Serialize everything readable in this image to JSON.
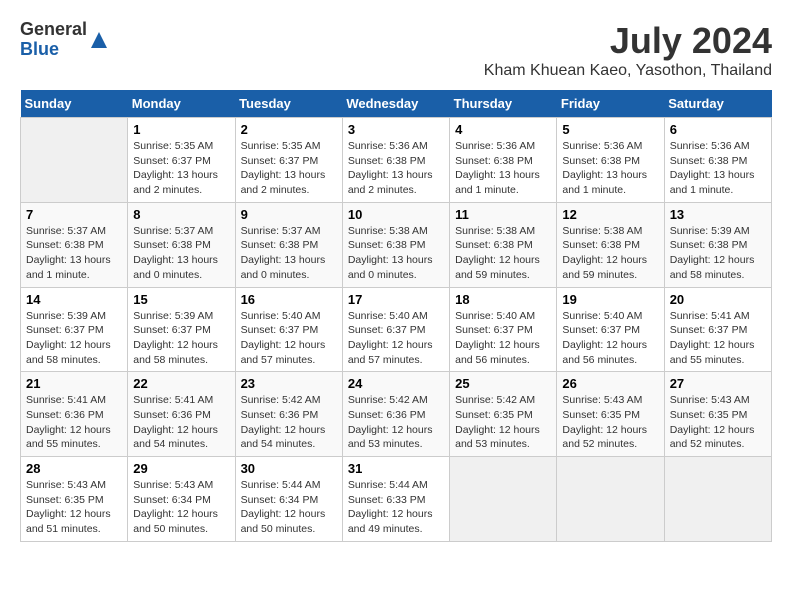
{
  "header": {
    "logo_general": "General",
    "logo_blue": "Blue",
    "month_title": "July 2024",
    "location": "Kham Khuean Kaeo, Yasothon, Thailand"
  },
  "days_of_week": [
    "Sunday",
    "Monday",
    "Tuesday",
    "Wednesday",
    "Thursday",
    "Friday",
    "Saturday"
  ],
  "weeks": [
    [
      {
        "day": "",
        "info": ""
      },
      {
        "day": "1",
        "info": "Sunrise: 5:35 AM\nSunset: 6:37 PM\nDaylight: 13 hours\nand 2 minutes."
      },
      {
        "day": "2",
        "info": "Sunrise: 5:35 AM\nSunset: 6:37 PM\nDaylight: 13 hours\nand 2 minutes."
      },
      {
        "day": "3",
        "info": "Sunrise: 5:36 AM\nSunset: 6:38 PM\nDaylight: 13 hours\nand 2 minutes."
      },
      {
        "day": "4",
        "info": "Sunrise: 5:36 AM\nSunset: 6:38 PM\nDaylight: 13 hours\nand 1 minute."
      },
      {
        "day": "5",
        "info": "Sunrise: 5:36 AM\nSunset: 6:38 PM\nDaylight: 13 hours\nand 1 minute."
      },
      {
        "day": "6",
        "info": "Sunrise: 5:36 AM\nSunset: 6:38 PM\nDaylight: 13 hours\nand 1 minute."
      }
    ],
    [
      {
        "day": "7",
        "info": "Sunrise: 5:37 AM\nSunset: 6:38 PM\nDaylight: 13 hours\nand 1 minute."
      },
      {
        "day": "8",
        "info": "Sunrise: 5:37 AM\nSunset: 6:38 PM\nDaylight: 13 hours\nand 0 minutes."
      },
      {
        "day": "9",
        "info": "Sunrise: 5:37 AM\nSunset: 6:38 PM\nDaylight: 13 hours\nand 0 minutes."
      },
      {
        "day": "10",
        "info": "Sunrise: 5:38 AM\nSunset: 6:38 PM\nDaylight: 13 hours\nand 0 minutes."
      },
      {
        "day": "11",
        "info": "Sunrise: 5:38 AM\nSunset: 6:38 PM\nDaylight: 12 hours\nand 59 minutes."
      },
      {
        "day": "12",
        "info": "Sunrise: 5:38 AM\nSunset: 6:38 PM\nDaylight: 12 hours\nand 59 minutes."
      },
      {
        "day": "13",
        "info": "Sunrise: 5:39 AM\nSunset: 6:38 PM\nDaylight: 12 hours\nand 58 minutes."
      }
    ],
    [
      {
        "day": "14",
        "info": "Sunrise: 5:39 AM\nSunset: 6:37 PM\nDaylight: 12 hours\nand 58 minutes."
      },
      {
        "day": "15",
        "info": "Sunrise: 5:39 AM\nSunset: 6:37 PM\nDaylight: 12 hours\nand 58 minutes."
      },
      {
        "day": "16",
        "info": "Sunrise: 5:40 AM\nSunset: 6:37 PM\nDaylight: 12 hours\nand 57 minutes."
      },
      {
        "day": "17",
        "info": "Sunrise: 5:40 AM\nSunset: 6:37 PM\nDaylight: 12 hours\nand 57 minutes."
      },
      {
        "day": "18",
        "info": "Sunrise: 5:40 AM\nSunset: 6:37 PM\nDaylight: 12 hours\nand 56 minutes."
      },
      {
        "day": "19",
        "info": "Sunrise: 5:40 AM\nSunset: 6:37 PM\nDaylight: 12 hours\nand 56 minutes."
      },
      {
        "day": "20",
        "info": "Sunrise: 5:41 AM\nSunset: 6:37 PM\nDaylight: 12 hours\nand 55 minutes."
      }
    ],
    [
      {
        "day": "21",
        "info": "Sunrise: 5:41 AM\nSunset: 6:36 PM\nDaylight: 12 hours\nand 55 minutes."
      },
      {
        "day": "22",
        "info": "Sunrise: 5:41 AM\nSunset: 6:36 PM\nDaylight: 12 hours\nand 54 minutes."
      },
      {
        "day": "23",
        "info": "Sunrise: 5:42 AM\nSunset: 6:36 PM\nDaylight: 12 hours\nand 54 minutes."
      },
      {
        "day": "24",
        "info": "Sunrise: 5:42 AM\nSunset: 6:36 PM\nDaylight: 12 hours\nand 53 minutes."
      },
      {
        "day": "25",
        "info": "Sunrise: 5:42 AM\nSunset: 6:35 PM\nDaylight: 12 hours\nand 53 minutes."
      },
      {
        "day": "26",
        "info": "Sunrise: 5:43 AM\nSunset: 6:35 PM\nDaylight: 12 hours\nand 52 minutes."
      },
      {
        "day": "27",
        "info": "Sunrise: 5:43 AM\nSunset: 6:35 PM\nDaylight: 12 hours\nand 52 minutes."
      }
    ],
    [
      {
        "day": "28",
        "info": "Sunrise: 5:43 AM\nSunset: 6:35 PM\nDaylight: 12 hours\nand 51 minutes."
      },
      {
        "day": "29",
        "info": "Sunrise: 5:43 AM\nSunset: 6:34 PM\nDaylight: 12 hours\nand 50 minutes."
      },
      {
        "day": "30",
        "info": "Sunrise: 5:44 AM\nSunset: 6:34 PM\nDaylight: 12 hours\nand 50 minutes."
      },
      {
        "day": "31",
        "info": "Sunrise: 5:44 AM\nSunset: 6:33 PM\nDaylight: 12 hours\nand 49 minutes."
      },
      {
        "day": "",
        "info": ""
      },
      {
        "day": "",
        "info": ""
      },
      {
        "day": "",
        "info": ""
      }
    ]
  ]
}
